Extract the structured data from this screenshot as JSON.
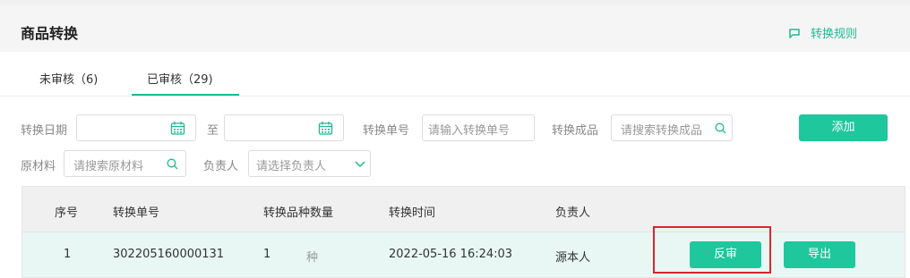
{
  "header": {
    "title": "商品转换",
    "rule_link": "转换规则"
  },
  "tabs": [
    {
      "label": "未审核（6)"
    },
    {
      "label": "已审核（29)",
      "active": true
    }
  ],
  "filters": {
    "date_label": "转换日期",
    "date_to": "至",
    "order_no_label": "转换单号",
    "order_no_placeholder": "请输入转换单号",
    "product_label": "转换成品",
    "product_placeholder": "请搜索转换成品",
    "material_label": "原材料",
    "material_placeholder": "请搜索原材料",
    "owner_label": "负责人",
    "owner_placeholder": "请选择负责人"
  },
  "actions": {
    "add_label": "添加"
  },
  "table": {
    "columns": [
      "序号",
      "转换单号",
      "转换品种数量",
      "转换时间",
      "负责人"
    ],
    "rows": [
      {
        "index": "1",
        "order_no": "302205160000131",
        "count": "1",
        "unit": "种",
        "time": "2022-05-16 16:24:03",
        "owner": "源本人",
        "reverse_label": "反审",
        "export_label": "导出"
      }
    ]
  },
  "colors": {
    "accent": "#1fc79d",
    "link": "#1fb894",
    "highlight": "#d9262c",
    "row_bg": "#e8f7f4"
  }
}
